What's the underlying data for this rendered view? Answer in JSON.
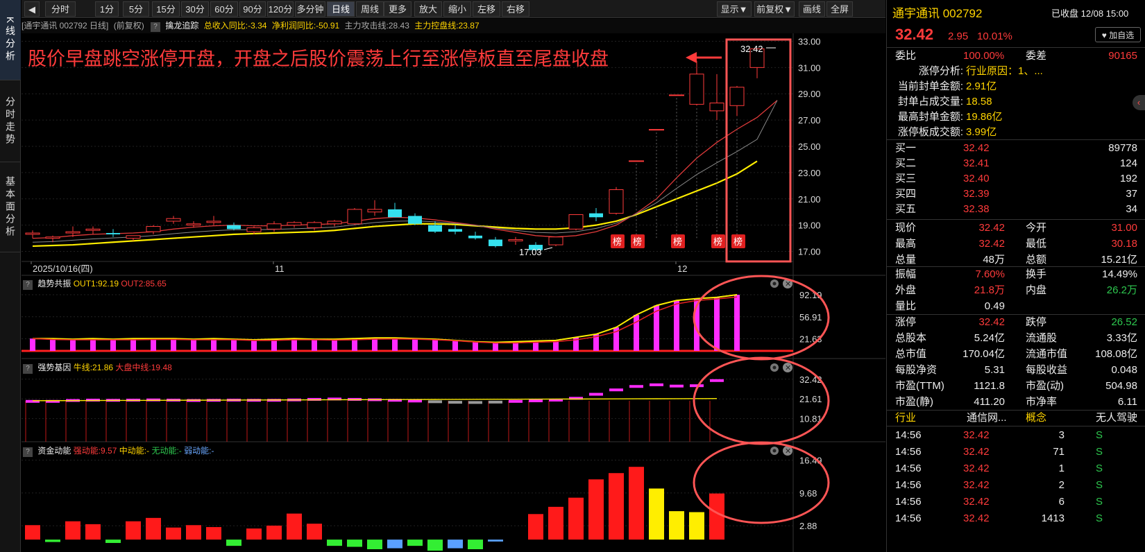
{
  "sidebar": {
    "tabs": [
      "K线分析",
      "分时走势",
      "基本面分析"
    ]
  },
  "toolbar": {
    "buttons": [
      "分时",
      "1分",
      "5分",
      "15分",
      "30分",
      "60分",
      "90分",
      "120分",
      "多分钟",
      "日线",
      "周线",
      "更多▼",
      "放大",
      "缩小",
      "左移",
      "右移"
    ],
    "active_label": "日线",
    "right_buttons": [
      "显示▼",
      "前复权▼",
      "画线",
      "全屏"
    ]
  },
  "infobar": {
    "stock": "[通宇通讯 002792 日线]",
    "adjust": "(前复权)",
    "indicator": "擒龙追踪",
    "rev": "总收入同比:-3.34",
    "profit": "净利润同比:-50.91",
    "attack": "主力攻击线:28.43",
    "control": "主力控盘线:23.87"
  },
  "annotation": "股价早盘跳空涨停开盘，开盘之后股价震荡上行至涨停板直至尾盘收盘",
  "main_chart": {
    "price_axis": [
      "33.00",
      "31.00",
      "29.00",
      "27.00",
      "25.00",
      "23.00",
      "21.00",
      "19.00",
      "17.00"
    ],
    "date_labels": [
      "2025/10/16(四)",
      "11",
      "12"
    ],
    "high_label": "32.42",
    "low_label": "17.03",
    "tag_label": "榜"
  },
  "panel1": {
    "title": "趋势共振",
    "out1": "OUT1:92.19",
    "out2": "OUT2:85.65",
    "axis": [
      "92.19",
      "56.91",
      "21.63"
    ]
  },
  "panel2": {
    "title": "强势基因",
    "bull": "牛线:21.86",
    "market": "大盘中线:19.48",
    "axis": [
      "32.42",
      "21.61",
      "10.81"
    ]
  },
  "panel3": {
    "title": "资金动能",
    "strong": "强动能:9.57",
    "mid": "中动能:-",
    "none": "无动能:-",
    "weak": "弱动能:-",
    "axis": [
      "16.49",
      "9.68",
      "2.88"
    ]
  },
  "chart_data": [
    {
      "type": "candlestick",
      "title": "通宇通讯 002792 日线",
      "ylim": [
        16.5,
        33.5
      ],
      "candles": [
        [
          18.3,
          18.6,
          18.0,
          18.4
        ],
        [
          18.0,
          18.2,
          17.7,
          18.1
        ],
        [
          18.4,
          18.9,
          18.1,
          18.5
        ],
        [
          18.6,
          18.9,
          18.3,
          18.7
        ],
        [
          18.4,
          18.7,
          18.1,
          18.3
        ],
        [
          18.0,
          18.2,
          17.8,
          18.2
        ],
        [
          18.5,
          19.0,
          18.3,
          18.9
        ],
        [
          19.3,
          19.7,
          19.1,
          19.5
        ],
        [
          19.0,
          19.3,
          18.8,
          19.1
        ],
        [
          19.2,
          19.7,
          19.0,
          19.3
        ],
        [
          19.0,
          19.2,
          18.6,
          18.7
        ],
        [
          18.5,
          18.9,
          18.3,
          18.8
        ],
        [
          18.7,
          19.3,
          18.5,
          19.1
        ],
        [
          19.0,
          19.3,
          18.8,
          19.2
        ],
        [
          18.8,
          19.3,
          18.6,
          19.2
        ],
        [
          19.1,
          19.4,
          18.9,
          19.3
        ],
        [
          19.1,
          20.3,
          19.0,
          20.2
        ],
        [
          20.0,
          20.9,
          19.7,
          20.2
        ],
        [
          20.2,
          20.7,
          19.6,
          19.6
        ],
        [
          19.7,
          19.9,
          19.0,
          19.1
        ],
        [
          19.0,
          19.3,
          18.4,
          18.5
        ],
        [
          18.7,
          19.0,
          18.3,
          18.5
        ],
        [
          18.2,
          18.5,
          17.9,
          18.0
        ],
        [
          17.9,
          18.1,
          17.3,
          17.4
        ],
        [
          17.8,
          18.1,
          17.5,
          17.9
        ],
        [
          17.5,
          17.7,
          17.03,
          17.1
        ],
        [
          17.5,
          18.1,
          17.4,
          18.1
        ],
        [
          18.7,
          19.6,
          18.6,
          19.8
        ],
        [
          19.9,
          20.3,
          19.3,
          19.6
        ],
        [
          19.9,
          21.9,
          19.8,
          21.7
        ],
        [
          23.87,
          23.87,
          23.87,
          23.87
        ],
        [
          26.26,
          26.26,
          26.26,
          26.26
        ],
        [
          28.89,
          28.89,
          28.89,
          28.89
        ],
        [
          28.2,
          31.5,
          28.1,
          30.5
        ],
        [
          27.7,
          30.5,
          27.0,
          28.3
        ],
        [
          28.1,
          29.6,
          27.3,
          29.5
        ],
        [
          31.0,
          32.42,
          30.18,
          32.42
        ]
      ],
      "ma_red": [
        18.0,
        18.05,
        18.2,
        18.3,
        18.35,
        18.4,
        18.5,
        18.7,
        18.85,
        18.95,
        19.0,
        18.95,
        18.95,
        19.0,
        19.05,
        19.1,
        19.3,
        19.5,
        19.6,
        19.55,
        19.4,
        19.2,
        19.0,
        18.7,
        18.45,
        18.2,
        18.1,
        18.2,
        18.5,
        19.0,
        19.9,
        21.0,
        22.6,
        24.1,
        25.3,
        26.3,
        27.2,
        28.5
      ],
      "ma_yellow": [
        17.4,
        17.45,
        17.5,
        17.6,
        17.7,
        17.8,
        17.9,
        18.0,
        18.1,
        18.2,
        18.3,
        18.35,
        18.4,
        18.45,
        18.5,
        18.6,
        18.75,
        18.9,
        19.0,
        19.1,
        19.1,
        19.05,
        18.95,
        18.85,
        18.75,
        18.7,
        18.7,
        18.8,
        19.0,
        19.3,
        19.8,
        20.4,
        21.0,
        21.6,
        22.2,
        22.9,
        23.87
      ]
    },
    {
      "type": "bar",
      "title": "趋势共振",
      "ylim": [
        0,
        100
      ],
      "values": [
        22,
        22,
        21,
        22,
        21,
        22,
        22,
        22,
        21,
        22,
        21,
        20,
        21,
        22,
        21,
        21,
        22,
        23,
        23,
        22,
        21,
        19,
        17,
        16,
        17,
        18,
        19,
        24,
        29,
        40,
        60,
        75,
        83,
        86,
        88,
        92.19
      ]
    },
    {
      "type": "bar",
      "title": "强势基因",
      "ylim": [
        0,
        35
      ],
      "values": [
        21,
        21,
        21.5,
        21.7,
        21.6,
        21.7,
        21.8,
        21.7,
        21.5,
        21.6,
        21.7,
        21.6,
        21.6,
        21.8,
        22.1,
        22.3,
        22.1,
        21.9,
        21.6,
        21.2,
        20.8,
        20.5,
        20.4,
        20.6,
        21.0,
        21.3,
        21.7,
        22.7,
        24.9,
        27.3,
        29.2,
        30.1,
        29.4,
        29.6,
        32.42
      ]
    },
    {
      "type": "bar",
      "title": "资金动能",
      "ylim": [
        -2,
        17
      ],
      "series": [
        {
          "name": "强动能",
          "values": [
            3.0,
            0,
            3.8,
            3.2,
            0,
            3.8,
            4.5,
            2.5,
            3.0,
            2.6,
            0,
            2.3,
            2.9,
            5.4,
            3.3,
            0,
            0,
            0,
            0,
            0,
            0,
            0,
            0,
            0,
            0,
            5.3,
            6.8,
            8.7,
            12.5,
            13.8,
            15.1,
            0,
            0,
            0,
            9.57
          ]
        },
        {
          "name": "中动能",
          "values": [
            0,
            0,
            0,
            0,
            0,
            0,
            0,
            0,
            0,
            0,
            0,
            0,
            0,
            0,
            0,
            0,
            0,
            0,
            0,
            0,
            0,
            0,
            0,
            0,
            0,
            0,
            0,
            0,
            0,
            0,
            0,
            10.6,
            5.9,
            5.7,
            0
          ]
        },
        {
          "name": "无动能",
          "values": [
            0,
            -0.5,
            0,
            0,
            -0.7,
            0,
            0,
            0,
            0,
            0,
            -1.3,
            0,
            0,
            0,
            0,
            -1.3,
            -1.5,
            -2.0,
            0,
            -1.3,
            -2.3,
            0,
            -2.0,
            0,
            0,
            0,
            0,
            0,
            0,
            0,
            0,
            0,
            0,
            0,
            0
          ]
        },
        {
          "name": "弱动能",
          "values": [
            0,
            0,
            0,
            0,
            0,
            0,
            0,
            0,
            0,
            0,
            0,
            0,
            0,
            0,
            0,
            0,
            0,
            0,
            -1.8,
            0,
            0,
            -1.8,
            0,
            -0.4,
            0,
            0,
            0,
            0,
            0,
            0,
            0,
            0,
            0,
            0,
            0
          ]
        }
      ]
    }
  ],
  "right_panel": {
    "name": "通宇通讯 002792",
    "status": "已收盘 12/08 15:00",
    "price": "32.42",
    "change": "2.95",
    "pct": "10.01%",
    "fav": "♥ 加自选",
    "weibi_label": "委比",
    "weibi": "100.00%",
    "weicha_label": "委差",
    "weicha": "90165",
    "limit": [
      {
        "label": "涨停分析:",
        "value": "行业原因：1、..."
      },
      {
        "label": "当前封单金额:",
        "value": "2.91亿"
      },
      {
        "label": "封单占成交量:",
        "value": "18.58"
      },
      {
        "label": "最高封单金额:",
        "value": "19.86亿"
      },
      {
        "label": "涨停板成交额:",
        "value": "3.99亿"
      }
    ],
    "bids": [
      [
        "买一",
        "32.42",
        "89778"
      ],
      [
        "买二",
        "32.41",
        "124"
      ],
      [
        "买三",
        "32.40",
        "192"
      ],
      [
        "买四",
        "32.39",
        "37"
      ],
      [
        "买五",
        "32.38",
        "34"
      ]
    ],
    "quote": [
      [
        "现价",
        "32.42",
        "今开",
        "31.00"
      ],
      [
        "最高",
        "32.42",
        "最低",
        "30.18"
      ],
      [
        "总量",
        "48万",
        "总额",
        "15.21亿"
      ],
      [
        "振幅",
        "7.60%",
        "换手",
        "14.49%"
      ],
      [
        "外盘",
        "21.8万",
        "内盘",
        "26.2万"
      ],
      [
        "量比",
        "0.49",
        "",
        ""
      ],
      [
        "涨停",
        "32.42",
        "跌停",
        "26.52"
      ],
      [
        "总股本",
        "5.24亿",
        "流通股",
        "3.33亿"
      ],
      [
        "总市值",
        "170.04亿",
        "流通市值",
        "108.08亿"
      ],
      [
        "每股净资",
        "5.31",
        "每股收益",
        "0.048"
      ],
      [
        "市盈(TTM)",
        "1121.8",
        "市盈(动)",
        "504.98"
      ],
      [
        "市盈(静)",
        "411.20",
        "市净率",
        "6.11"
      ],
      [
        "行业",
        "通信网...",
        "概念",
        "无人驾驶"
      ]
    ],
    "trades": [
      [
        "14:56",
        "32.42",
        "3",
        "S"
      ],
      [
        "14:56",
        "32.42",
        "71",
        "S"
      ],
      [
        "14:56",
        "32.42",
        "1",
        "S"
      ],
      [
        "14:56",
        "32.42",
        "2",
        "S"
      ],
      [
        "14:56",
        "32.42",
        "6",
        "S"
      ],
      [
        "14:56",
        "32.42",
        "1413",
        "S"
      ]
    ]
  }
}
